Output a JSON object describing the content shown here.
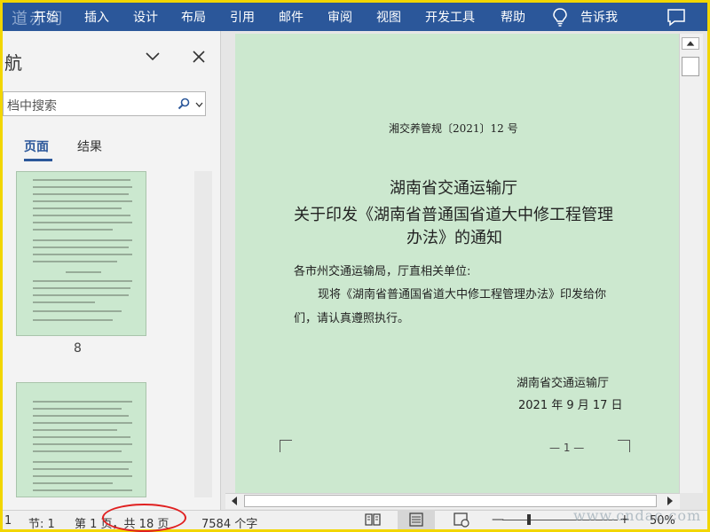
{
  "ribbon": {
    "watermark": "道赤习",
    "menu": [
      "开始",
      "插入",
      "设计",
      "布局",
      "引用",
      "邮件",
      "审阅",
      "视图",
      "开发工具",
      "帮助"
    ],
    "tell_me": "告诉我"
  },
  "nav": {
    "title": "航",
    "search_placeholder": "档中搜索",
    "tab_pages": "页面",
    "tab_results": "结果",
    "page_label": "8"
  },
  "document": {
    "number": "湘交养管规〔2021〕12 号",
    "title_line1": "湖南省交通运输厅",
    "title_line2": "关于印发《湖南省普通国省道大中修工程管理",
    "title_line3": "办法》的通知",
    "greeting": "各市州交通运输局，厅直相关单位:",
    "body_line1": "现将《湖南省普通国省道大中修工程管理办法》印发给你",
    "body_line2": "们，请认真遵照执行。",
    "sign_org": "湖南省交通运输厅",
    "sign_date": "2021 年 9 月 17 日",
    "page_number": "— 1 —"
  },
  "status": {
    "page_index": "1",
    "section": "节: 1",
    "page_of": "第 1 页，共 18 页",
    "word_count": "7584 个字",
    "zoom": "50%",
    "zoom_percent": 50,
    "watermark": "www.cndac.com"
  },
  "colors": {
    "ribbon": "#2b579a",
    "page_bg": "#cce8cf",
    "highlight": "#e02020",
    "frame": "#f2d600"
  }
}
